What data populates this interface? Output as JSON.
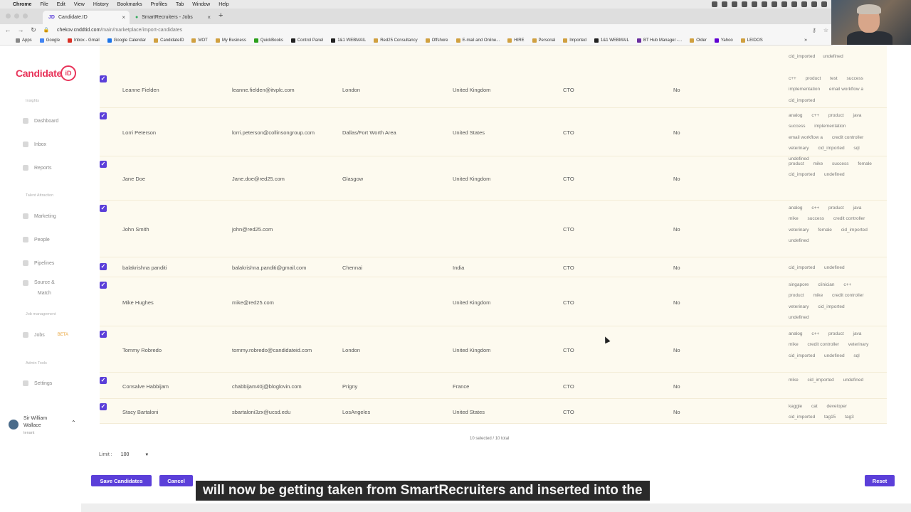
{
  "mac_menu": [
    "Chrome",
    "File",
    "Edit",
    "View",
    "History",
    "Bookmarks",
    "Profiles",
    "Tab",
    "Window",
    "Help"
  ],
  "tabs": [
    {
      "favicon": "JD",
      "label": "Candidate.ID"
    },
    {
      "favicon": "",
      "label": "SmartRecruiters - Jobs"
    }
  ],
  "address": {
    "prefix": "chekov.cnddtid.com",
    "path": "/main/marketplace/import-candidates"
  },
  "bookmarks": [
    "Apps",
    "Google",
    "Inbox - Gmail",
    "Google Calendar",
    "CandidateID",
    "MOT",
    "My Business",
    "QuickBooks",
    "Control Panel",
    "1&1 WEBMAIL",
    "Red25 Consultancy",
    "Offshore",
    "E-mail and Online...",
    "HIRE",
    "Personal",
    "Imported",
    "1&1 WEBMAIL",
    "BT Hub Manager -...",
    "Older",
    "Yahoo",
    "LEIDOS"
  ],
  "brand": {
    "name": "Candidate",
    "badge": "iD"
  },
  "sidebar": {
    "sections": {
      "insights": "Insights",
      "talent": "Talent Attraction",
      "jobmgmt": "Job management",
      "admin": "Admin Tools"
    },
    "items": {
      "dashboard": "Dashboard",
      "inbox": "Inbox",
      "reports": "Reports",
      "marketing": "Marketing",
      "people": "People",
      "pipelines": "Pipelines",
      "source1": "Source &",
      "source2": "Match",
      "jobs": "Jobs",
      "beta": "BETA",
      "settings": "Settings"
    },
    "user": {
      "name1": "Sir William",
      "name2": "Wallace",
      "role": "tenant"
    }
  },
  "top_tags": [
    "cid_imported",
    "undefined"
  ],
  "candidates": [
    {
      "name": "Leanne Fielden",
      "email": "leanne.fielden@itvplc.com",
      "city": "London",
      "country": "United Kingdom",
      "title": "CTO",
      "flag": "No",
      "tags": [
        "c++",
        "product",
        "test",
        "success",
        "implementation",
        "email workflow a",
        "cid_imported"
      ]
    },
    {
      "name": "Lorri Peterson",
      "email": "lorri.peterson@collinsongroup.com",
      "city": "Dallas/Fort Worth Area",
      "country": "United States",
      "title": "CTO",
      "flag": "No",
      "tags": [
        "analog",
        "c++",
        "product",
        "java",
        "success",
        "implementation",
        "email workflow a",
        "credit controller",
        "veterinary",
        "cid_imported",
        "sql",
        "undefined"
      ]
    },
    {
      "name": "Jane Doe",
      "email": "Jane.doe@red25.com",
      "city": "Glasgow",
      "country": "United Kingdom",
      "title": "CTO",
      "flag": "No",
      "tags": [
        "product",
        "mike",
        "success",
        "female",
        "cid_imported",
        "undefined"
      ]
    },
    {
      "name": "John Smith",
      "email": "john@red25.com",
      "city": "",
      "country": "",
      "title": "CTO",
      "flag": "No",
      "tags": [
        "analog",
        "c++",
        "product",
        "java",
        "mike",
        "success",
        "credit controller",
        "veterinary",
        "female",
        "cid_imported",
        "undefined"
      ]
    },
    {
      "name": "balakrishna panditi",
      "email": "balakrishna.panditi@gmail.com",
      "city": "Chennai",
      "country": "India",
      "title": "CTO",
      "flag": "No",
      "tags": [
        "cid_imported",
        "undefined"
      ]
    },
    {
      "name": "Mike Hughes",
      "email": "mike@red25.com",
      "city": "",
      "country": "United Kingdom",
      "title": "CTO",
      "flag": "No",
      "tags": [
        "singapore",
        "clinician",
        "c++",
        "product",
        "mike",
        "credit controller",
        "veterinary",
        "cid_imported",
        "undefined"
      ]
    },
    {
      "name": "Tommy Robredo",
      "email": "tommy.robredo@candidateid.com",
      "city": "London",
      "country": "United Kingdom",
      "title": "CTO",
      "flag": "No",
      "tags": [
        "analog",
        "c++",
        "product",
        "java",
        "mike",
        "credit controller",
        "veterinary",
        "cid_imported",
        "undefined",
        "sql"
      ]
    },
    {
      "name": "Consalve Habbijam",
      "email": "chabbijam40j@bloglovin.com",
      "city": "Prigny",
      "country": "France",
      "title": "CTO",
      "flag": "No",
      "tags": [
        "mike",
        "cid_imported",
        "undefined"
      ]
    },
    {
      "name": "Stacy Bartaloni",
      "email": "sbartaloni3zx@ucsd.edu",
      "city": "LosAngeles",
      "country": "United States",
      "title": "CTO",
      "flag": "No",
      "tags": [
        "kaggle",
        "cat",
        "developer",
        "cid_imported",
        "tag15",
        "tag3"
      ]
    }
  ],
  "summary": "10 selected / 10 total",
  "limit": {
    "label": "Limit :",
    "value": "100"
  },
  "buttons": {
    "save": "Save Candidates",
    "cancel": "Cancel",
    "reset": "Reset"
  },
  "caption": "will now be getting taken from SmartRecruiters and inserted into the"
}
